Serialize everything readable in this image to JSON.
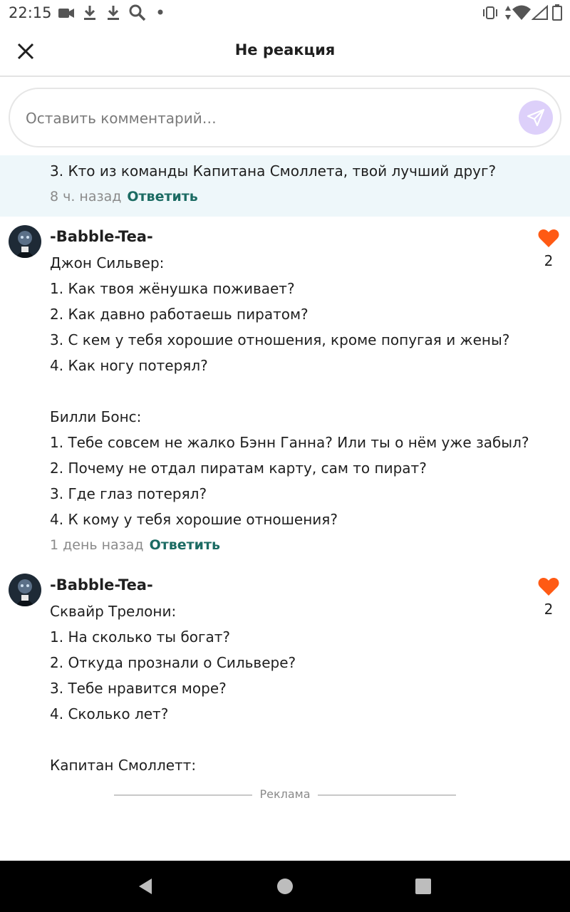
{
  "status_bar": {
    "time": "22:15",
    "left_icons": [
      "video-camera-icon",
      "download-icon",
      "download-icon",
      "search-icon",
      "dot-icon"
    ],
    "right_icons": [
      "vibrate-icon",
      "data-arrows-icon",
      "wifi-icon",
      "signal-icon",
      "battery-icon"
    ]
  },
  "header": {
    "title": "Не реакция",
    "close_icon": "close-icon"
  },
  "comment_input": {
    "placeholder": "Оставить комментарий…",
    "value": "",
    "send_icon": "send-icon",
    "send_bg": "#ddd0fa"
  },
  "previous_comment": {
    "last_line": "3. Кто из команды Капитана Смоллета, твой лучший друг?",
    "time": "8 ч. назад",
    "reply_label": "Ответить",
    "bg": "#eef7fa"
  },
  "comments": [
    {
      "author": "-Babble-Tea-",
      "lines": [
        "Джон Сильвер:",
        "1. Как твоя жёнушка поживает?",
        "2. Как давно работаешь пиратом?",
        "3. С кем у тебя хорошие отношения, кроме попугая и жены?",
        "4. Как ногу потерял?",
        "",
        "Билли Бонс:",
        "1. Тебе совсем не жалко Бэнн Ганна? Или ты о нём уже забыл?",
        "2. Почему не отдал пиратам карту, сам то пират?",
        "3. Где глаз потерял?",
        "4. К кому у тебя хорошие отношения?"
      ],
      "time": "1 день назад",
      "reply_label": "Ответить",
      "likes": "2"
    },
    {
      "author": "-Babble-Tea-",
      "lines": [
        "Сквайр Трелони:",
        "1. На сколько ты богат?",
        "2. Откуда прознали о Сильвере?",
        "3. Тебе нравится море?",
        "4. Сколько лет?",
        "",
        "Капитан Смоллетт:"
      ],
      "likes": "2"
    }
  ],
  "ad_label": "Реклама",
  "colors": {
    "accent_reply": "#1b6b63",
    "heart": "#ff5a14"
  },
  "nav_bar": [
    "back-icon",
    "home-icon",
    "recents-icon"
  ]
}
